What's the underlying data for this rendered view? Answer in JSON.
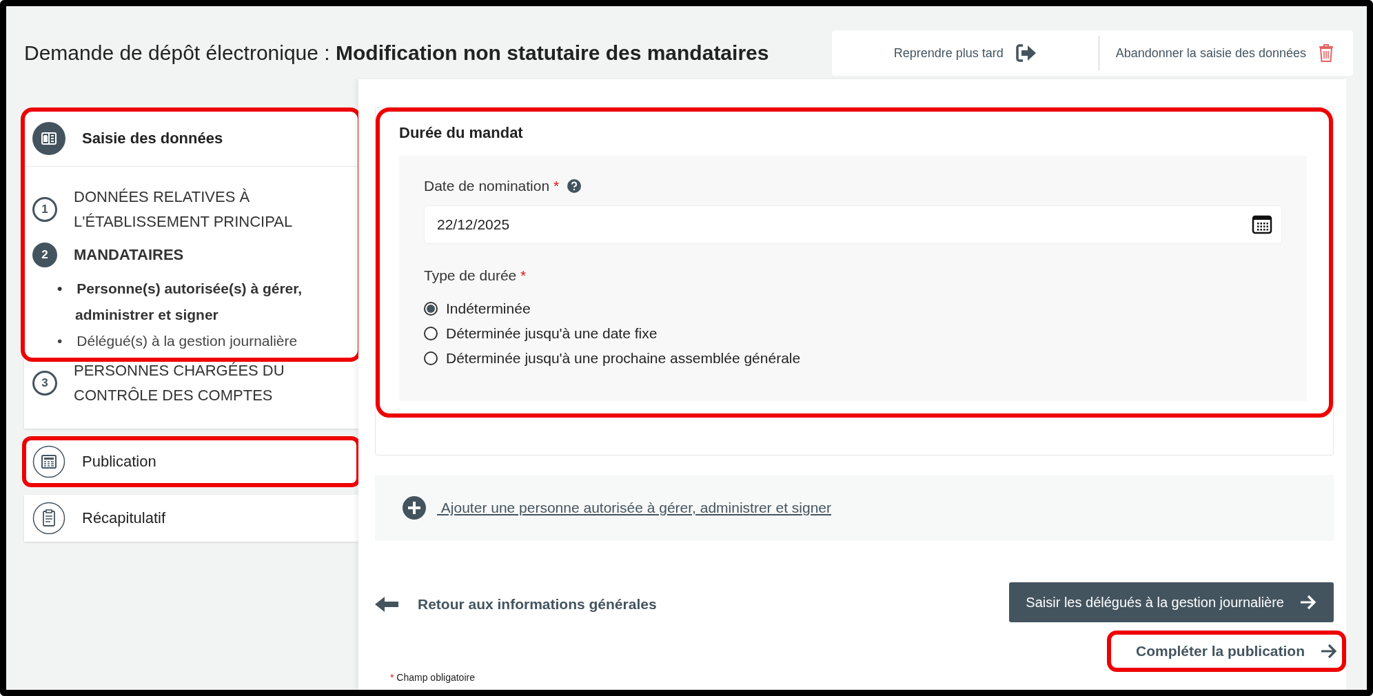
{
  "header": {
    "title_prefix": "Demande de dépôt électronique :",
    "title_main": "Modification non statutaire des mandataires"
  },
  "actions": [
    {
      "kind": "later",
      "label": "Reprendre plus tard"
    },
    {
      "kind": "abandon",
      "label": "Abandonner la saisie des données"
    }
  ],
  "sidebar": {
    "data_entry": {
      "title": "Saisie des données",
      "highlighted": true,
      "steps": [
        {
          "number": "1",
          "label": "DONNÉES RELATIVES À L'ÉTABLISSEMENT PRINCIPAL",
          "selected": false,
          "highlighted": true
        },
        {
          "number": "2",
          "label": "MANDATAIRES",
          "selected": true,
          "highlighted": true,
          "children": [
            {
              "bullet": "•",
              "label": "Personne(s) autorisée(s) à gérer, administrer et signer",
              "selected": true
            },
            {
              "bullet": "•",
              "label": "Délégué(s) à la gestion journalière",
              "selected": false
            }
          ]
        },
        {
          "number": "3",
          "label": "PERSONNES CHARGÉES DU CONTRÔLE DES COMPTES",
          "selected": false,
          "highlighted": false
        }
      ]
    },
    "items": [
      {
        "kind": "publication",
        "label": "Publication",
        "highlighted": true
      },
      {
        "kind": "summary",
        "label": "Récapitulatif",
        "highlighted": false
      }
    ]
  },
  "form": {
    "title": "Durée du mandat",
    "highlighted": true,
    "date_field": {
      "label": "Date de nomination",
      "required_mark": "*",
      "value": "22/12/2025"
    },
    "duration": {
      "label": "Type de durée",
      "required_mark": "*",
      "options": [
        {
          "label": "Indéterminée",
          "selected": true
        },
        {
          "label": "Déterminée jusqu'à une date fixe",
          "selected": false
        },
        {
          "label": "Déterminée jusqu'à une prochaine assemblée générale",
          "selected": false
        }
      ]
    }
  },
  "add_link": "Ajouter une personne autorisée à gérer, administrer et signer",
  "back_link": "Retour aux informations générales",
  "next_button": {
    "label": "Saisir les délégués à la gestion journalière"
  },
  "complete_button": {
    "label": "Compléter la publication",
    "highlighted": true
  },
  "footnote": {
    "mark": "*",
    "text": "Champ obligatoire"
  }
}
